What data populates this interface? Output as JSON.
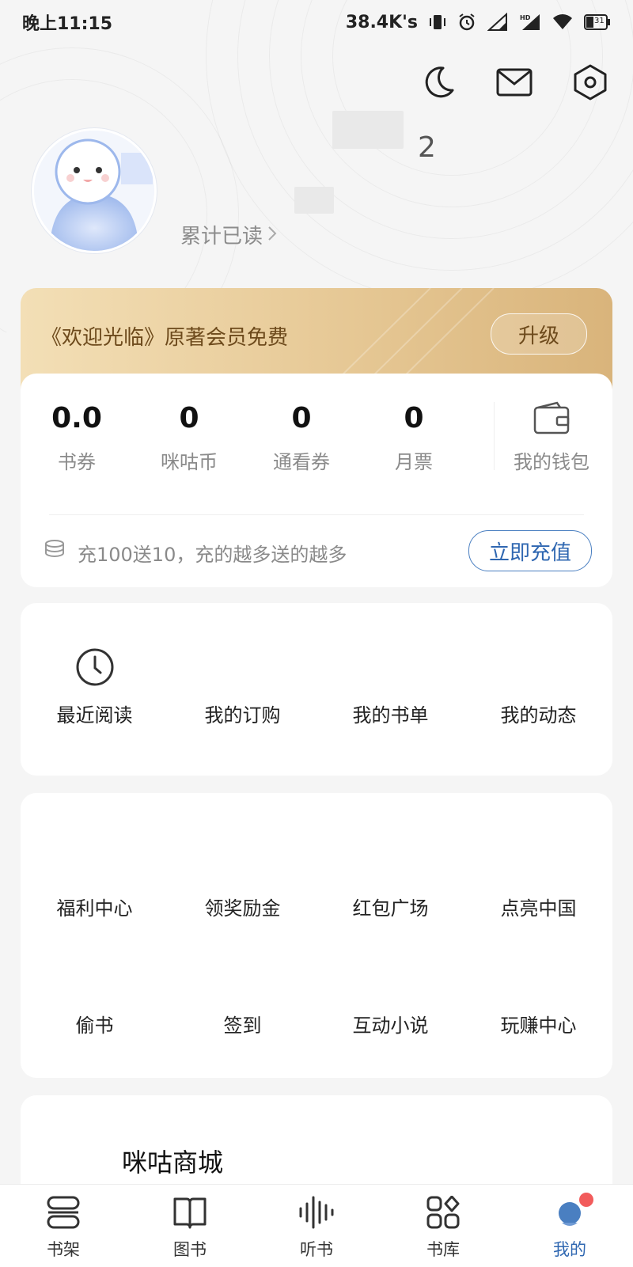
{
  "status_bar": {
    "time": "晚上11:15",
    "net_speed": "38.4K's",
    "battery": "31"
  },
  "header": {
    "icons": [
      "moon-icon",
      "mail-icon",
      "settings-icon"
    ],
    "level_number": "2",
    "read_link": "累计已读"
  },
  "vip": {
    "text": "《欢迎光临》原著会员免费",
    "upgrade_label": "升级"
  },
  "wallet": {
    "stats": [
      {
        "value": "0.0",
        "label": "书券"
      },
      {
        "value": "0",
        "label": "咪咕币"
      },
      {
        "value": "0",
        "label": "通看券"
      },
      {
        "value": "0",
        "label": "月票"
      }
    ],
    "wallet_label": "我的钱包",
    "promo_text": "充100送10，充的越多送的越多",
    "recharge_label": "立即充值"
  },
  "quick_menu": [
    {
      "label": "最近阅读",
      "icon": "clock-icon"
    },
    {
      "label": "我的订购"
    },
    {
      "label": "我的书单"
    },
    {
      "label": "我的动态"
    }
  ],
  "activity_menu": {
    "row1": [
      {
        "label": "福利中心"
      },
      {
        "label": "领奖励金"
      },
      {
        "label": "红包广场"
      },
      {
        "label": "点亮中国"
      }
    ],
    "row2": [
      {
        "label": "偷书"
      },
      {
        "label": "签到"
      },
      {
        "label": "互动小说"
      },
      {
        "label": "玩赚中心"
      }
    ]
  },
  "mall": {
    "title": "咪咕商城"
  },
  "tab_bar": {
    "tabs": [
      {
        "label": "书架",
        "icon": "bookshelf-icon"
      },
      {
        "label": "图书",
        "icon": "book-icon"
      },
      {
        "label": "听书",
        "icon": "audio-wave-icon"
      },
      {
        "label": "书库",
        "icon": "grid-icon"
      },
      {
        "label": "我的",
        "icon": "profile-icon"
      }
    ],
    "active_tab": "我的"
  },
  "colors": {
    "accent_blue": "#2f67b1",
    "vip_gold": "#e6c895",
    "badge_red": "#f25b5b"
  }
}
